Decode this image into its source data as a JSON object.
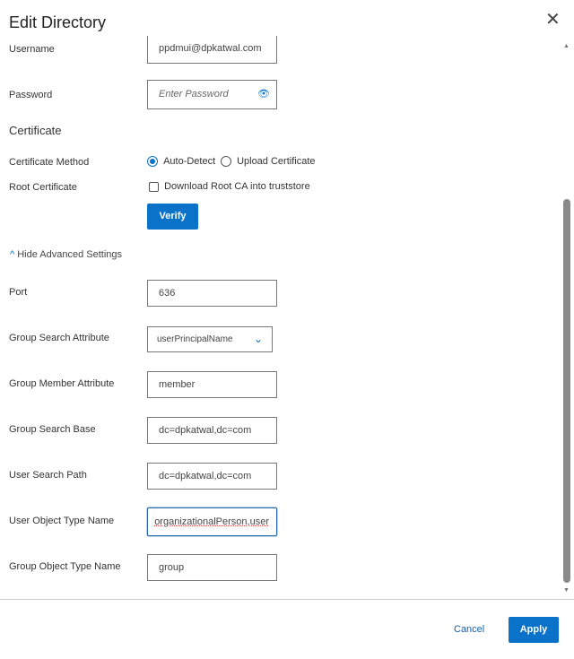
{
  "dialog": {
    "title": "Edit Directory"
  },
  "fields": {
    "username": {
      "label": "Username",
      "value": "ppdmui@dpkatwal.com"
    },
    "password": {
      "label": "Password",
      "placeholder": "Enter Password"
    },
    "certificate_heading": "Certificate",
    "certificate_method": {
      "label": "Certificate Method",
      "options": [
        "Auto-Detect",
        "Upload Certificate"
      ],
      "selected": "Auto-Detect"
    },
    "root_certificate": {
      "label": "Root Certificate",
      "checkbox_label": "Download Root CA into truststore",
      "checked": false
    },
    "verify_label": "Verify",
    "advanced_toggle": "Hide Advanced Settings",
    "port": {
      "label": "Port",
      "value": "636"
    },
    "group_search_attribute": {
      "label": "Group Search Attribute",
      "value": "userPrincipalName"
    },
    "group_member_attribute": {
      "label": "Group Member Attribute",
      "value": "member"
    },
    "group_search_base": {
      "label": "Group Search Base",
      "value": "dc=dpkatwal,dc=com"
    },
    "user_search_path": {
      "label": "User Search Path",
      "value": "dc=dpkatwal,dc=com"
    },
    "user_object_type_name": {
      "label": "User Object Type Name",
      "value": "organizationalPerson,user"
    },
    "group_object_type_name": {
      "label": "Group Object Type Name",
      "value": "group"
    }
  },
  "footer": {
    "cancel": "Cancel",
    "apply": "Apply"
  },
  "colors": {
    "accent": "#0a72c8"
  }
}
